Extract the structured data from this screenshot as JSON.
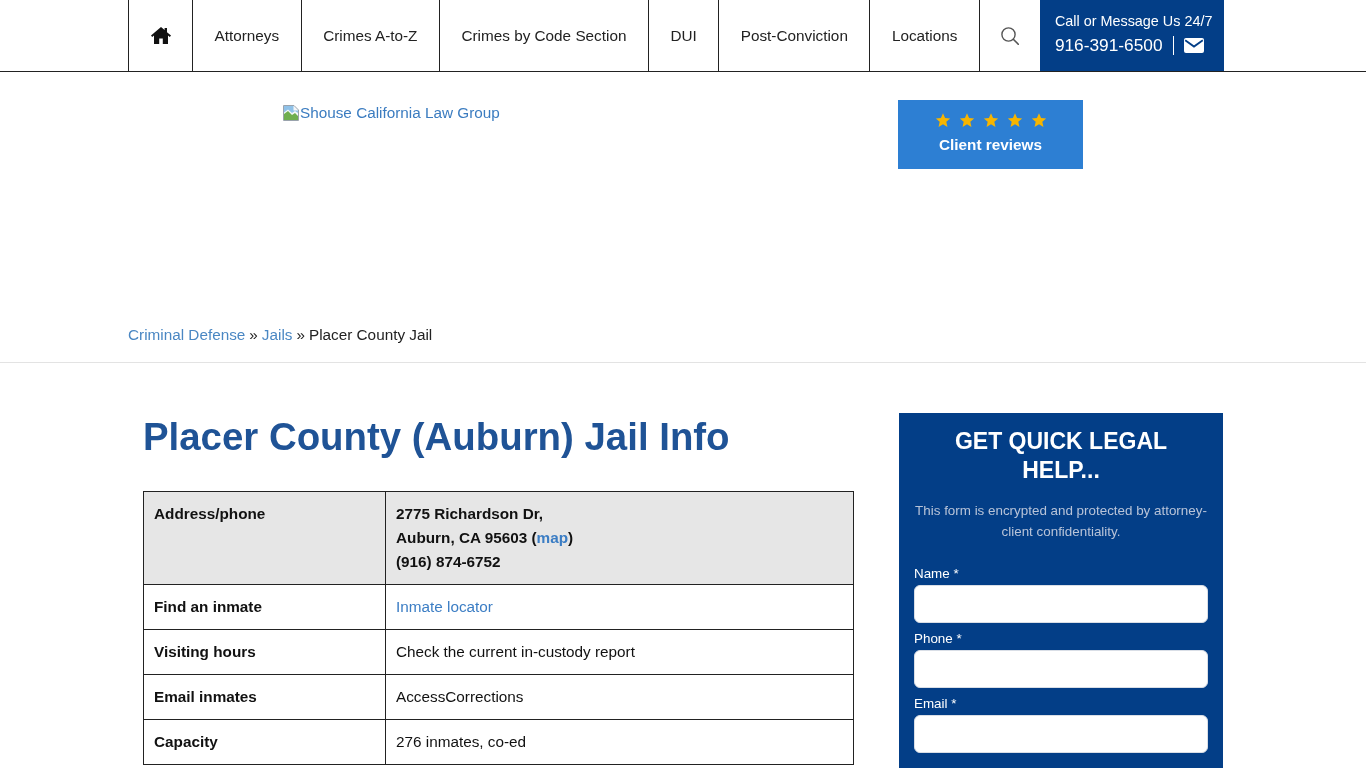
{
  "nav": {
    "items": [
      "Attorneys",
      "Crimes A-to-Z",
      "Crimes by Code Section",
      "DUI",
      "Post-Conviction",
      "Locations"
    ],
    "contact": {
      "caption": "Call or Message Us 24/7",
      "phone": "916-391-6500"
    }
  },
  "logo": {
    "alt_text": "Shouse California Law Group"
  },
  "reviews": {
    "stars": 5,
    "label": "Client reviews"
  },
  "breadcrumb": [
    {
      "kind": "link",
      "text": "Criminal Defense"
    },
    {
      "kind": "separator",
      "text": "»"
    },
    {
      "kind": "link",
      "text": "Jails"
    },
    {
      "kind": "separator",
      "text": "»"
    },
    {
      "kind": "current",
      "text": "Placer County Jail"
    }
  ],
  "title": "Placer County (Auburn) Jail Info",
  "table": {
    "rows": [
      {
        "label": "Address/phone",
        "shaded": true,
        "bold_value": true,
        "lines": [
          [
            {
              "kind": "text",
              "text": "2775 Richardson Dr,"
            }
          ],
          [
            {
              "kind": "text",
              "text": "Auburn, CA 95603 ("
            },
            {
              "kind": "link",
              "text": "map"
            },
            {
              "kind": "text",
              "text": ")"
            }
          ],
          [
            {
              "kind": "text",
              "text": "(916) 874-6752"
            }
          ]
        ]
      },
      {
        "label": "Find an inmate",
        "shaded": false,
        "bold_value": false,
        "lines": [
          [
            {
              "kind": "link",
              "text": "Inmate locator"
            }
          ]
        ]
      },
      {
        "label": "Visiting hours",
        "shaded": false,
        "bold_value": false,
        "lines": [
          [
            {
              "kind": "text",
              "text": "Check the current in-custody report"
            }
          ]
        ]
      },
      {
        "label": "Email inmates",
        "shaded": false,
        "bold_value": false,
        "lines": [
          [
            {
              "kind": "text",
              "text": "AccessCorrections"
            }
          ]
        ]
      },
      {
        "label": "Capacity",
        "shaded": false,
        "bold_value": false,
        "lines": [
          [
            {
              "kind": "text",
              "text": "276 inmates, co-ed"
            }
          ]
        ]
      }
    ]
  },
  "form": {
    "title": "GET QUICK LEGAL HELP...",
    "note": "This form is encrypted and protected by attorney-client confidentiality.",
    "fields": [
      {
        "label": "Name *"
      },
      {
        "label": "Phone *"
      },
      {
        "label": "Email *"
      }
    ]
  }
}
